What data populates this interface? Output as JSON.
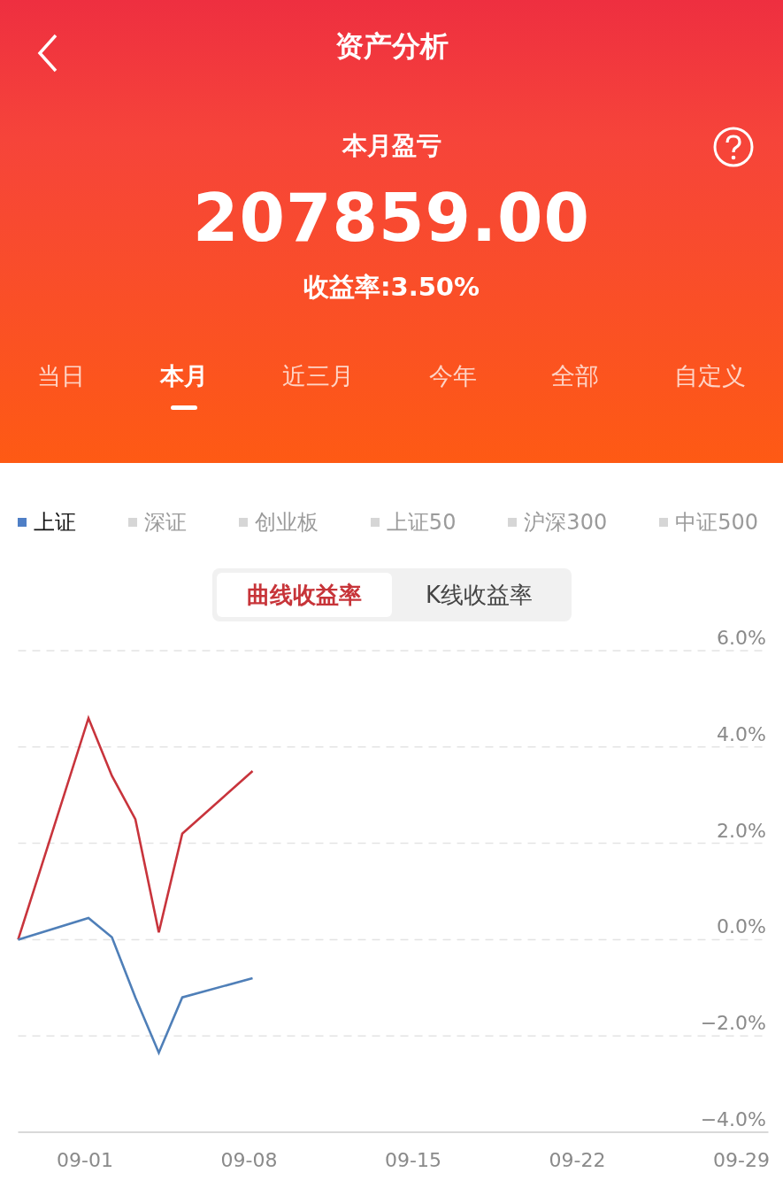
{
  "nav": {
    "title": "资产分析"
  },
  "summary": {
    "label": "本月盈亏",
    "amount": "207859.00",
    "rate": "收益率:3.50%"
  },
  "periods": [
    {
      "label": "当日",
      "selected": false
    },
    {
      "label": "本月",
      "selected": true
    },
    {
      "label": "近三月",
      "selected": false
    },
    {
      "label": "今年",
      "selected": false
    },
    {
      "label": "全部",
      "selected": false
    },
    {
      "label": "自定义",
      "selected": false
    }
  ],
  "indices": [
    {
      "label": "上证",
      "selected": true
    },
    {
      "label": "深证",
      "selected": false
    },
    {
      "label": "创业板",
      "selected": false
    },
    {
      "label": "上证50",
      "selected": false
    },
    {
      "label": "沪深300",
      "selected": false
    },
    {
      "label": "中证500",
      "selected": false
    }
  ],
  "modes": [
    {
      "label": "曲线收益率",
      "selected": true
    },
    {
      "label": "K线收益率",
      "selected": false
    }
  ],
  "chart_data": {
    "type": "line",
    "grid": true,
    "ylim": [
      -4,
      6
    ],
    "categories": [
      null,
      null,
      null,
      "09-01",
      null,
      null,
      null,
      null,
      null,
      null,
      "09-08",
      null,
      null,
      null,
      null,
      null,
      null,
      "09-15",
      null,
      null,
      null,
      null,
      null,
      null,
      "09-22",
      null,
      null,
      null,
      null,
      null,
      null,
      "09-29",
      null
    ],
    "yticks": [
      {
        "value": 6,
        "label": "6.0%"
      },
      {
        "value": 4,
        "label": "4.0%"
      },
      {
        "value": 2,
        "label": "2.0%"
      },
      {
        "value": 0,
        "label": "0.0%"
      },
      {
        "value": -2,
        "label": "−2.0%"
      },
      {
        "value": -4,
        "label": "−4.0%"
      }
    ],
    "series": [
      {
        "color": "#c8343c",
        "values": [
          0,
          null,
          null,
          4.6,
          3.4,
          2.5,
          0.15,
          2.2,
          null,
          null,
          3.5,
          null,
          null,
          null,
          null,
          null,
          null,
          null,
          null,
          null,
          null,
          null,
          null,
          null,
          null,
          null,
          null,
          null,
          null,
          null,
          null,
          null,
          null
        ]
      },
      {
        "color": "#4f7fb8",
        "values": [
          0,
          null,
          null,
          0.45,
          0.05,
          -1.2,
          -2.35,
          -1.2,
          null,
          null,
          -0.8,
          null,
          null,
          null,
          null,
          null,
          null,
          null,
          null,
          null,
          null,
          null,
          null,
          null,
          null,
          null,
          null,
          null,
          null,
          null,
          null,
          null,
          null
        ]
      }
    ]
  }
}
